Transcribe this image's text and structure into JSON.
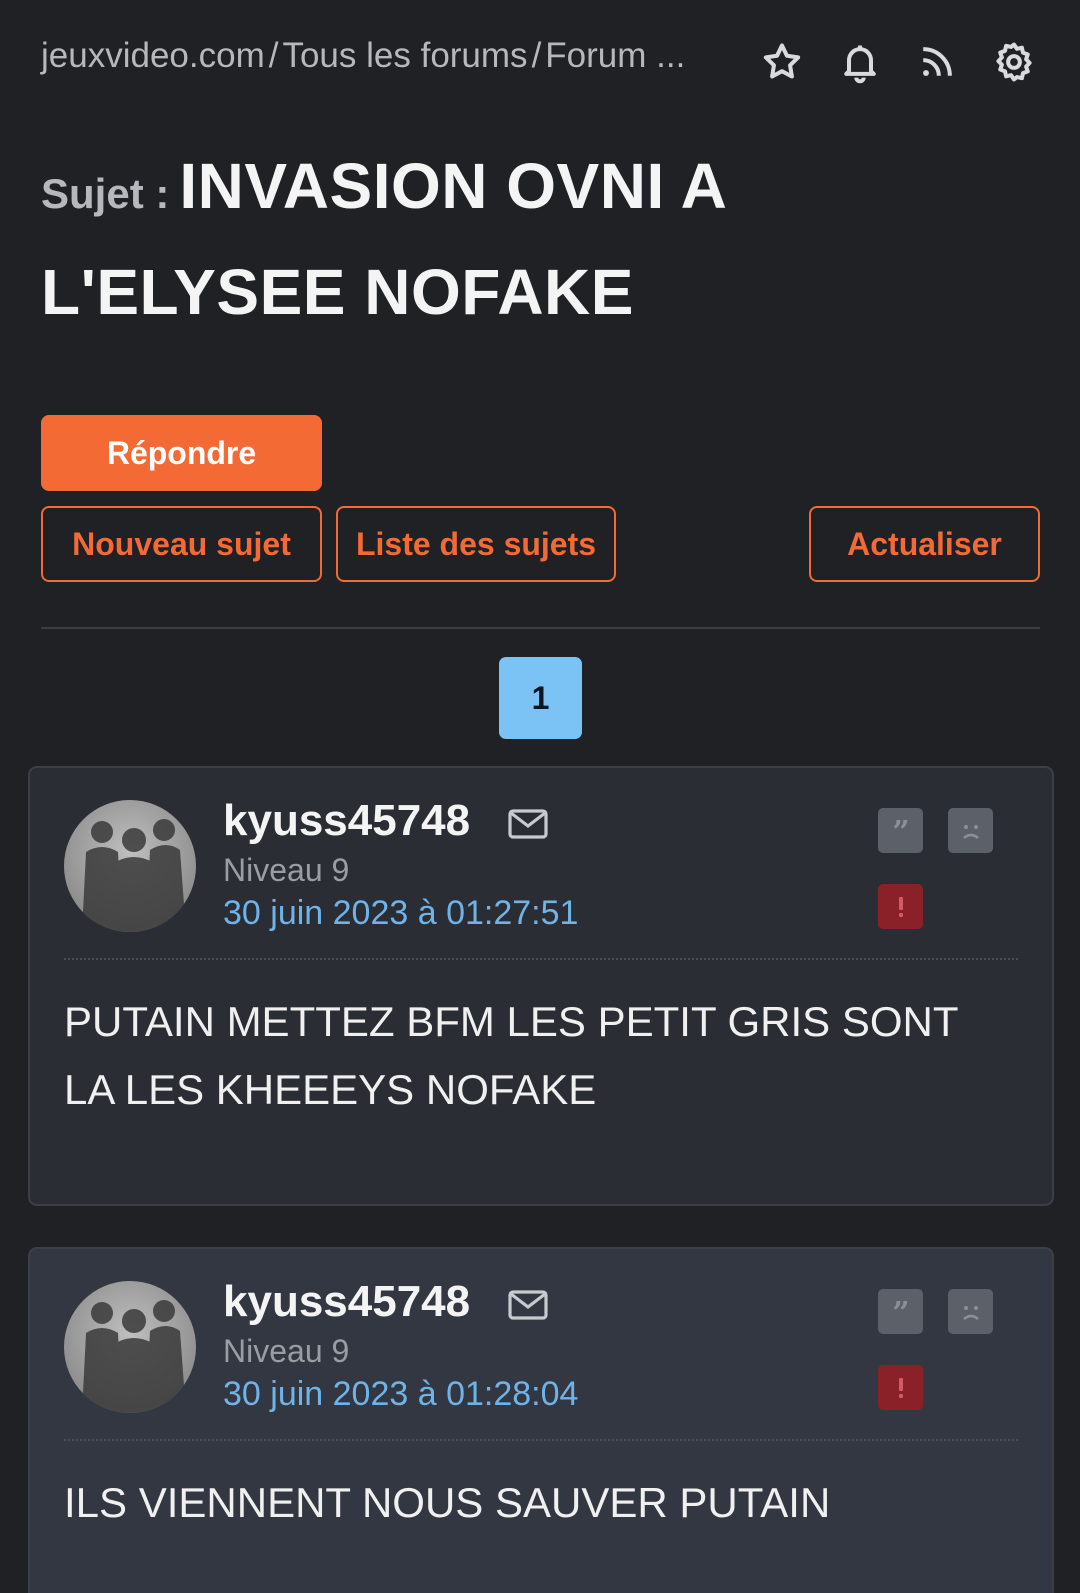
{
  "header": {
    "breadcrumb": [
      "jeuxvideo.com",
      "Tous les forums",
      "Forum ..."
    ],
    "separator": "/",
    "icons": [
      "star-icon",
      "bell-icon",
      "rss-icon",
      "gear-icon"
    ]
  },
  "topic": {
    "prefix": "Sujet :",
    "title": "INVASION OVNI A L'ELYSEE NOFAKE"
  },
  "actions": {
    "reply": "Répondre",
    "new_topic": "Nouveau sujet",
    "topic_list": "Liste des sujets",
    "refresh": "Actualiser"
  },
  "pagination": {
    "current_page": "1"
  },
  "posts": [
    {
      "author": "kyuss45748",
      "level": "Niveau 9",
      "date": "30 juin 2023 à 01:27:51",
      "body": "PUTAIN METTEZ BFM LES PETIT GRIS SONT LA LES KHEEEYS NOFAKE"
    },
    {
      "author": "kyuss45748",
      "level": "Niveau 9",
      "date": "30 juin 2023 à 01:28:04",
      "body": "ILS VIENNENT NOUS SAUVER PUTAIN"
    }
  ],
  "colors": {
    "background": "#1f2125",
    "accent": "#f36a35",
    "page_active": "#7cc3f5",
    "date_link": "#6fb3e8",
    "report": "#8a2128"
  }
}
